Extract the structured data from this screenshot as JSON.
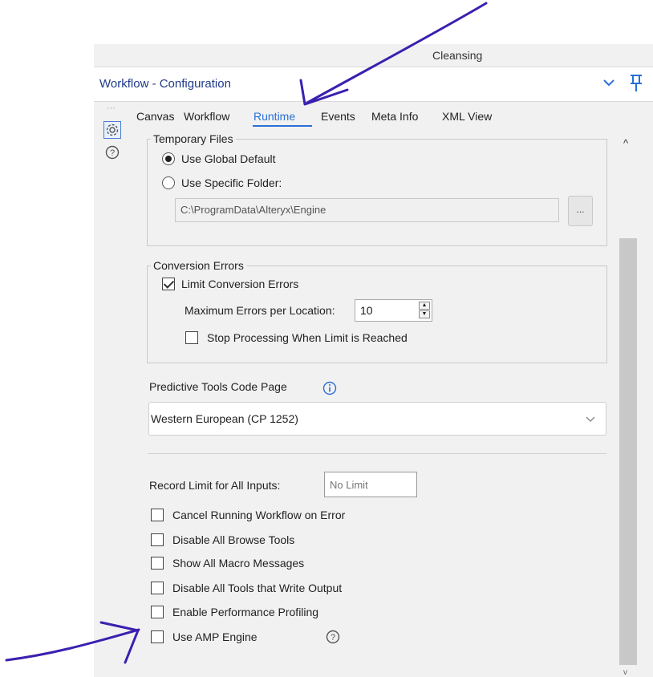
{
  "window": {
    "name": "Cleansing",
    "title": "Workflow - Configuration"
  },
  "tabs": [
    {
      "label": "Canvas"
    },
    {
      "label": "Workflow"
    },
    {
      "label": "Runtime"
    },
    {
      "label": "Events"
    },
    {
      "label": "Meta Info"
    },
    {
      "label": "XML View"
    }
  ],
  "active_tab": "Runtime",
  "temporary_files": {
    "legend": "Temporary Files",
    "use_global_default": "Use Global Default",
    "use_specific_folder": "Use Specific Folder:",
    "folder_path": "C:\\ProgramData\\Alteryx\\Engine",
    "browse_label": "...",
    "selected": "Use Global Default"
  },
  "conversion_errors": {
    "legend": "Conversion Errors",
    "limit_label": "Limit Conversion Errors",
    "limit_checked": true,
    "max_errors_label": "Maximum Errors per Location:",
    "max_errors_value": "10",
    "stop_label": "Stop Processing When Limit is Reached",
    "stop_checked": false
  },
  "predictive": {
    "label": "Predictive Tools Code Page",
    "selected": "Western European (CP 1252)"
  },
  "record_limit": {
    "label": "Record Limit for All Inputs:",
    "placeholder": "No Limit"
  },
  "options": [
    {
      "label": "Cancel Running Workflow on Error",
      "checked": false
    },
    {
      "label": "Disable All Browse Tools",
      "checked": false
    },
    {
      "label": "Show All Macro Messages",
      "checked": false
    },
    {
      "label": "Disable All Tools that Write Output",
      "checked": false
    },
    {
      "label": "Enable Performance Profiling",
      "checked": false
    },
    {
      "label": "Use AMP Engine",
      "checked": false
    }
  ],
  "colors": {
    "accent": "#2a6fd6",
    "title": "#1f3a8a",
    "annotation": "#3b1fb0"
  },
  "icons": {
    "dropdown": "chevron-down-icon",
    "pin": "pin-icon",
    "settings": "gear-icon",
    "help": "help-icon",
    "info": "info-icon"
  }
}
